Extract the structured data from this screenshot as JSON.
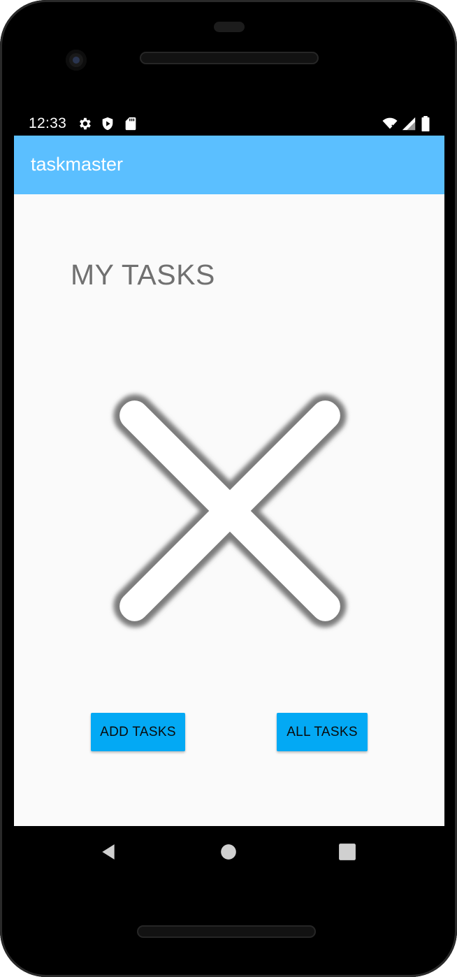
{
  "status_bar": {
    "time": "12:33",
    "icons_left": [
      "gear-icon",
      "shield-icon",
      "sd-card-icon"
    ],
    "icons_right": [
      "wifi-icon",
      "signal-icon",
      "battery-icon"
    ]
  },
  "app_bar": {
    "title": "taskmaster",
    "color": "#5bbfff"
  },
  "main": {
    "heading": "MY TASKS",
    "image_icon": "close-x-icon",
    "buttons": {
      "add_tasks": "ADD TASKS",
      "all_tasks": "ALL TASKS"
    },
    "button_color": "#03a9f4"
  },
  "nav_bar": {
    "icons": [
      "back-icon",
      "home-icon",
      "recents-icon"
    ]
  }
}
